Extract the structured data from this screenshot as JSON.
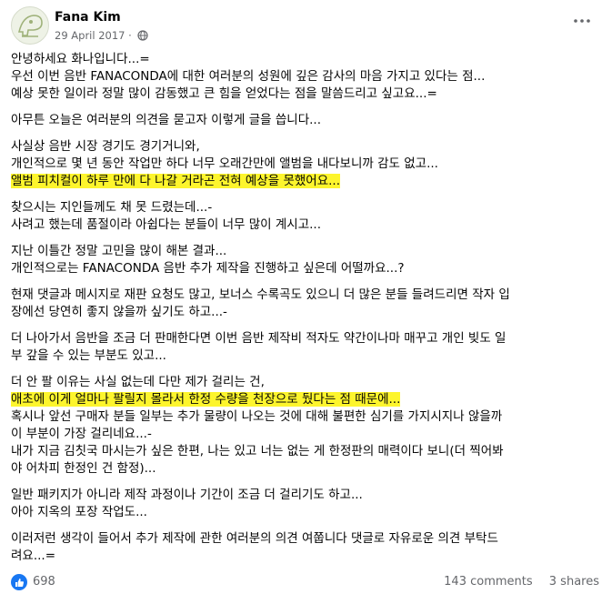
{
  "post": {
    "author": "Fana Kim",
    "date": "29 April 2017 ·",
    "lines": [
      "안녕하세요 화나입니다...=",
      "우선 이번 음반 FANACONDA에 대한 여러분의 성원에 깊은 감사의 마음 가지고 있다는 점...",
      "예상 못한 일이라 정말 많이 감동했고 큰 힘을 얻었다는 점을 말씀드리고 싶고요...=",
      "아무튼 오늘은 여러분의 의견을 묻고자 이렇게 글을 씁니다...",
      "사실상 음반 시장 경기도 경기거니와,",
      "개인적으로 몇 년 동안 작업만 하다 너무 오래간만에 앨범을 내다보니까 감도 없고...",
      "앨범 피치컬이 하루 만에 다 나갈 거라곤 전혀 예상을 못했어요...",
      "찾으시는 지인들께도 채 못 드렸는데...-",
      "사려고 했는데 품절이라 아쉽다는 분들이 너무 많이 계시고...",
      "지난 이틀간 정말 고민을 많이 해본 결과...",
      "개인적으로는 FANACONDA 음반 추가 제작을 진행하고 싶은데 어떨까요...?",
      "현재 댓글과 메시지로 재판 요청도 많고, 보너스 수록곡도 있으니 더 많은 분들 들려드리면 작자 입",
      "장에선 당연히 좋지 않을까 싶기도 하고...-",
      "더 나아가서 음반을 조금 더 판매한다면 이번 음반 제작비 적자도 약간이나마 매꾸고 개인 빚도 일",
      "부 갚을 수 있는 부분도 있고...",
      "더 안 팔 이유는 사실 없는데 다만 제가 걸리는 건,",
      "애초에 이게 얼마나 팔릴지 몰라서 한정 수량을 천장으로 뒀다는 점 때문에...",
      "혹시나 앞선 구매자 분들 일부는 추가 물량이 나오는 것에 대해 불편한 심기를 가지시지나 않을까",
      "이 부분이 가장 걸리네요...-",
      "내가 지금 김칫국 마시는가 싶은 한편, 나는 있고 너는 없는 게 한정판의 매력이다 보니(더 찍어봐",
      "야 어차피 한정인 건 함정)...",
      "일반 패키지가 아니라 제작 과정이나 기간이 조금 더 걸리기도 하고...",
      "아아 지옥의 포장 작업도...",
      "이러저런 생각이 들어서 추가 제작에 관한 여러분의 의견 여쭙니다 댓글로 자유로운 의견 부탁드",
      "려요...="
    ]
  },
  "footer": {
    "likes": "698",
    "comments": "143 comments",
    "shares": "3 shares"
  }
}
